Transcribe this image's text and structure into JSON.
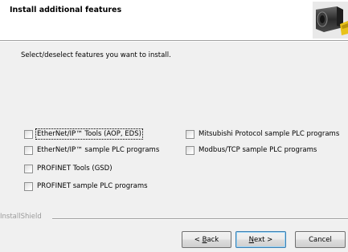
{
  "header": {
    "title": "Install additional features",
    "logo_icon": "scanner-device-icon"
  },
  "instruction": "Select/deselect features you want to install.",
  "features": [
    {
      "label": "EtherNet/IP™ Tools (AOP, EDS)",
      "checked": false,
      "focused": true
    },
    {
      "label": "EtherNet/IP™ sample PLC programs",
      "checked": false
    },
    {
      "label": "PROFINET Tools (GSD)",
      "checked": false
    },
    {
      "label": "PROFINET sample PLC programs",
      "checked": false
    },
    {
      "label": "Mitsubishi Protocol sample PLC programs",
      "checked": false
    },
    {
      "label": "Modbus/TCP sample PLC programs",
      "checked": false
    }
  ],
  "installshield_label": "InstallShield",
  "buttons": {
    "back": {
      "prefix": "< ",
      "mnemonic": "B",
      "rest": "ack"
    },
    "next": {
      "mnemonic": "N",
      "rest": "ext >"
    },
    "cancel": "Cancel"
  }
}
